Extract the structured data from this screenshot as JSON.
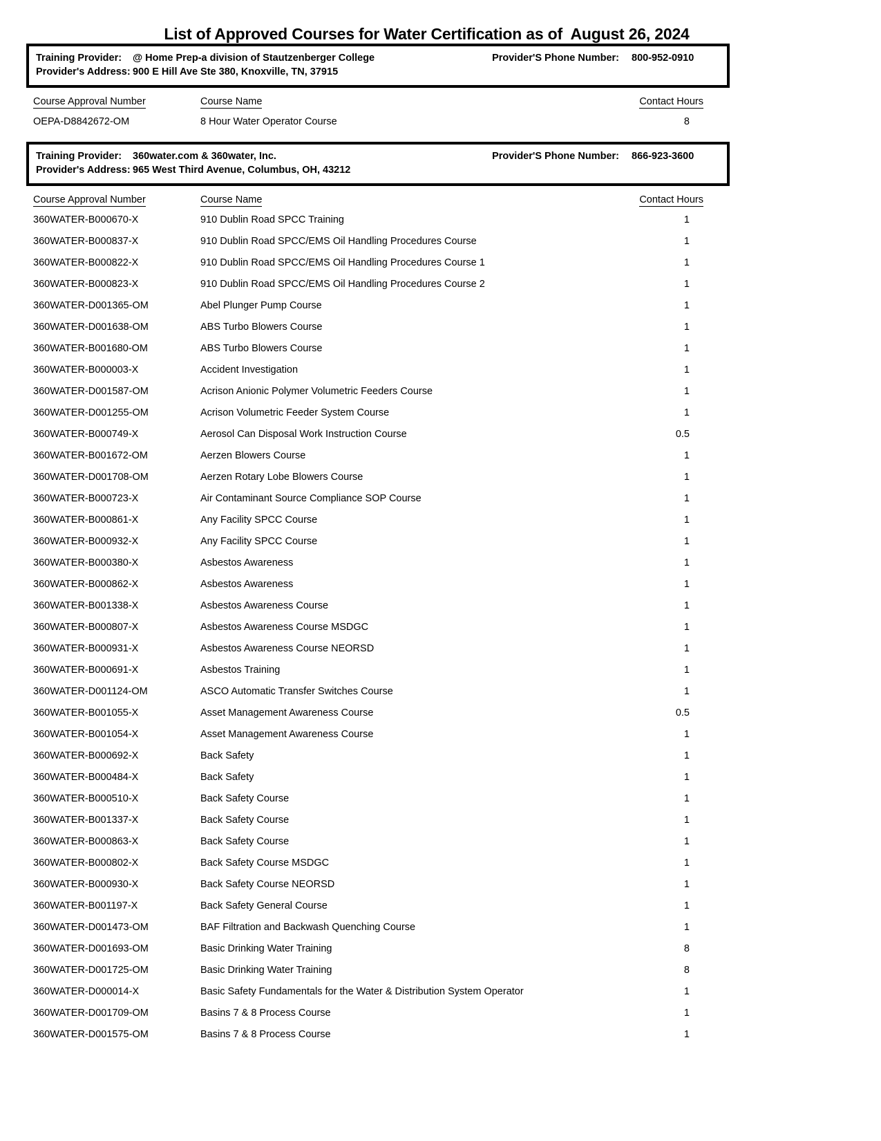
{
  "document": {
    "title_prefix": "List of Approved Courses for Water Certification as of ",
    "title_date": " August 26, 2024",
    "title_full": "List of Approved Courses for Water Certification as of  August 26, 2024"
  },
  "labels": {
    "training_provider": "Training Provider:",
    "providers_address": "Provider's Address:",
    "phone_number": "Provider'S Phone Number:",
    "col_approval_number": "Course Approval Number",
    "col_course_name": "Course Name",
    "col_contact_hours": "Contact Hours"
  },
  "providers": [
    {
      "name": "@ Home Prep-a division of Stautzenberger College",
      "address": "900 E Hill Ave Ste 380,  Knoxville,  TN,  37915",
      "phone": "800-952-0910",
      "courses": [
        {
          "approval_number": "OEPA-D8842672-OM",
          "course_name": "8 Hour Water Operator Course",
          "contact_hours": "8"
        }
      ]
    },
    {
      "name": "360water.com & 360water, Inc.",
      "address": "965 West Third Avenue,  Columbus,  OH,  43212",
      "phone": "866-923-3600",
      "courses": [
        {
          "approval_number": "360WATER-B000670-X",
          "course_name": "910 Dublin Road SPCC Training",
          "contact_hours": "1"
        },
        {
          "approval_number": "360WATER-B000837-X",
          "course_name": "910 Dublin Road SPCC/EMS Oil Handling Procedures Course",
          "contact_hours": "1"
        },
        {
          "approval_number": "360WATER-B000822-X",
          "course_name": "910 Dublin Road SPCC/EMS Oil Handling Procedures Course 1",
          "contact_hours": "1"
        },
        {
          "approval_number": "360WATER-B000823-X",
          "course_name": "910 Dublin Road SPCC/EMS Oil Handling Procedures Course 2",
          "contact_hours": "1"
        },
        {
          "approval_number": "360WATER-D001365-OM",
          "course_name": "Abel Plunger Pump Course",
          "contact_hours": "1"
        },
        {
          "approval_number": "360WATER-D001638-OM",
          "course_name": "ABS Turbo Blowers Course",
          "contact_hours": "1"
        },
        {
          "approval_number": "360WATER-B001680-OM",
          "course_name": "ABS Turbo Blowers Course",
          "contact_hours": "1"
        },
        {
          "approval_number": "360WATER-B000003-X",
          "course_name": "Accident Investigation",
          "contact_hours": "1"
        },
        {
          "approval_number": "360WATER-D001587-OM",
          "course_name": "Acrison Anionic Polymer Volumetric Feeders Course",
          "contact_hours": "1"
        },
        {
          "approval_number": "360WATER-D001255-OM",
          "course_name": "Acrison Volumetric Feeder System Course",
          "contact_hours": "1"
        },
        {
          "approval_number": "360WATER-B000749-X",
          "course_name": "Aerosol Can Disposal Work Instruction Course",
          "contact_hours": "0.5"
        },
        {
          "approval_number": "360WATER-B001672-OM",
          "course_name": "Aerzen Blowers Course",
          "contact_hours": "1"
        },
        {
          "approval_number": "360WATER-D001708-OM",
          "course_name": "Aerzen Rotary Lobe Blowers Course",
          "contact_hours": "1"
        },
        {
          "approval_number": "360WATER-B000723-X",
          "course_name": "Air Contaminant Source Compliance SOP Course",
          "contact_hours": "1"
        },
        {
          "approval_number": "360WATER-B000861-X",
          "course_name": "Any Facility SPCC Course",
          "contact_hours": "1"
        },
        {
          "approval_number": "360WATER-B000932-X",
          "course_name": "Any Facility SPCC Course",
          "contact_hours": "1"
        },
        {
          "approval_number": "360WATER-B000380-X",
          "course_name": "Asbestos Awareness",
          "contact_hours": "1"
        },
        {
          "approval_number": "360WATER-B000862-X",
          "course_name": "Asbestos Awareness",
          "contact_hours": "1"
        },
        {
          "approval_number": "360WATER-B001338-X",
          "course_name": "Asbestos Awareness Course",
          "contact_hours": "1"
        },
        {
          "approval_number": "360WATER-B000807-X",
          "course_name": "Asbestos Awareness Course MSDGC",
          "contact_hours": "1"
        },
        {
          "approval_number": "360WATER-B000931-X",
          "course_name": "Asbestos Awareness Course NEORSD",
          "contact_hours": "1"
        },
        {
          "approval_number": "360WATER-B000691-X",
          "course_name": "Asbestos Training",
          "contact_hours": "1"
        },
        {
          "approval_number": "360WATER-D001124-OM",
          "course_name": "ASCO Automatic Transfer Switches Course",
          "contact_hours": "1"
        },
        {
          "approval_number": "360WATER-B001055-X",
          "course_name": "Asset Management Awareness Course",
          "contact_hours": "0.5"
        },
        {
          "approval_number": "360WATER-B001054-X",
          "course_name": "Asset Management Awareness Course",
          "contact_hours": "1"
        },
        {
          "approval_number": "360WATER-B000692-X",
          "course_name": "Back Safety",
          "contact_hours": "1"
        },
        {
          "approval_number": "360WATER-B000484-X",
          "course_name": "Back Safety",
          "contact_hours": "1"
        },
        {
          "approval_number": "360WATER-B000510-X",
          "course_name": "Back Safety Course",
          "contact_hours": "1"
        },
        {
          "approval_number": "360WATER-B001337-X",
          "course_name": "Back Safety Course",
          "contact_hours": "1"
        },
        {
          "approval_number": "360WATER-B000863-X",
          "course_name": "Back Safety Course",
          "contact_hours": "1"
        },
        {
          "approval_number": "360WATER-B000802-X",
          "course_name": "Back Safety Course MSDGC",
          "contact_hours": "1"
        },
        {
          "approval_number": "360WATER-B000930-X",
          "course_name": "Back Safety Course NEORSD",
          "contact_hours": "1"
        },
        {
          "approval_number": "360WATER-B001197-X",
          "course_name": "Back Safety General Course",
          "contact_hours": "1"
        },
        {
          "approval_number": "360WATER-D001473-OM",
          "course_name": "BAF Filtration and Backwash Quenching Course",
          "contact_hours": "1"
        },
        {
          "approval_number": "360WATER-D001693-OM",
          "course_name": "Basic Drinking Water Training",
          "contact_hours": "8"
        },
        {
          "approval_number": "360WATER-D001725-OM",
          "course_name": "Basic Drinking Water Training",
          "contact_hours": "8"
        },
        {
          "approval_number": "360WATER-D000014-X",
          "course_name": "Basic Safety Fundamentals for the Water & Distribution System Operator",
          "contact_hours": "1"
        },
        {
          "approval_number": "360WATER-D001709-OM",
          "course_name": "Basins 7 & 8 Process Course",
          "contact_hours": "1"
        },
        {
          "approval_number": "360WATER-D001575-OM",
          "course_name": "Basins 7 & 8 Process Course",
          "contact_hours": "1"
        }
      ]
    }
  ]
}
